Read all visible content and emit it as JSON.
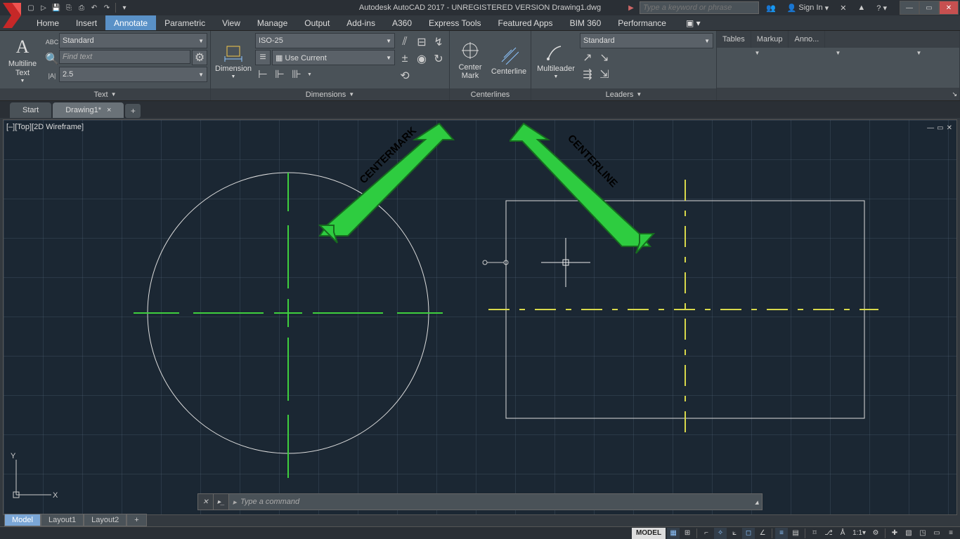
{
  "title": "Autodesk AutoCAD 2017 - UNREGISTERED VERSION   Drawing1.dwg",
  "search_placeholder": "Type a keyword or phrase",
  "sign_in": "Sign In",
  "menu_tabs": [
    "Home",
    "Insert",
    "Annotate",
    "Parametric",
    "View",
    "Manage",
    "Output",
    "Add-ins",
    "A360",
    "Express Tools",
    "Featured Apps",
    "BIM 360",
    "Performance"
  ],
  "active_menu_tab": 2,
  "ribbon": {
    "text_panel": {
      "multiline_btn": "Multiline\nText",
      "style_dd": "Standard",
      "find_placeholder": "Find text",
      "height_dd": "2.5",
      "title": "Text"
    },
    "dim_panel": {
      "dimension_btn": "Dimension",
      "style_dd": "ISO-25",
      "layer_label": "Use Current",
      "title": "Dimensions"
    },
    "centerlines_panel": {
      "center_mark": "Center\nMark",
      "centerline": "Centerline",
      "title": "Centerlines"
    },
    "leaders_panel": {
      "multileader": "Multileader",
      "style_dd": "Standard",
      "title": "Leaders"
    },
    "secondary_tabs": [
      "Tables",
      "Markup",
      "Anno..."
    ]
  },
  "file_tabs": {
    "items": [
      "Start",
      "Drawing1*"
    ],
    "active": 1
  },
  "viewport_label": "[–][Top][2D Wireframe]",
  "annotations": {
    "left": "CENTERMARK",
    "right": "CENTERLINE"
  },
  "cmd_placeholder": "Type a command",
  "layout_tabs": {
    "items": [
      "Model",
      "Layout1",
      "Layout2"
    ],
    "active": 0
  },
  "status": {
    "model": "MODEL",
    "ratio": "1:1"
  }
}
